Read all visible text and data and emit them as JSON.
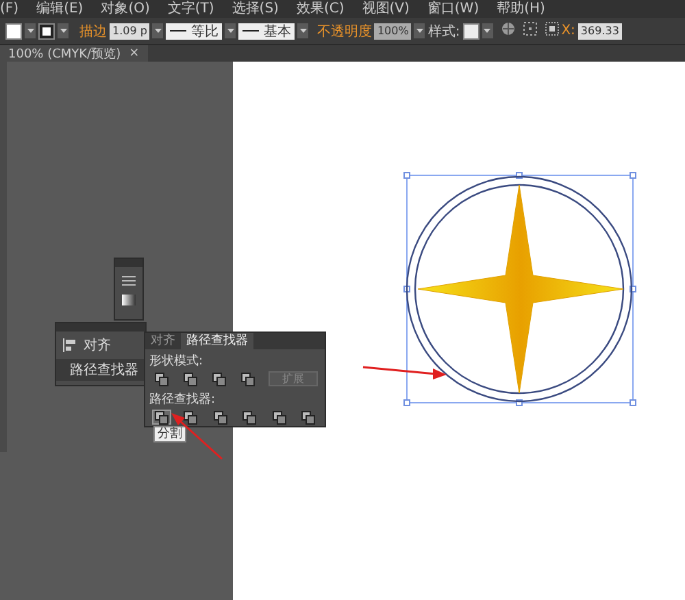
{
  "menu_bar": {
    "items": [
      "(F)",
      "编辑(E)",
      "对象(O)",
      "文字(T)",
      "选择(S)",
      "效果(C)",
      "视图(V)",
      "窗口(W)",
      "帮助(H)"
    ]
  },
  "control_bar": {
    "stroke_label": "描边",
    "stroke_weight": "1.09 p",
    "stroke_profile": "等比",
    "brush": "基本",
    "opacity_label": "不透明度",
    "opacity": "100%",
    "style_label": "样式:",
    "x_label": "X:",
    "x_value": "369.33"
  },
  "document_tab": {
    "title": "100% (CMYK/预览)",
    "close": "×"
  },
  "dock_panel": {
    "items": [
      {
        "label": "对齐",
        "selected": false
      },
      {
        "label": "路径查找器",
        "selected": true
      }
    ]
  },
  "pathfinder_panel": {
    "tabs": [
      {
        "label": "对齐",
        "selected": false
      },
      {
        "label": "路径查找器",
        "selected": true
      }
    ],
    "shape_modes_label": "形状模式:",
    "expand_button": {
      "label": "扩展",
      "disabled": true
    },
    "pathfinders_label": "路径查找器:",
    "pathfinder_buttons": [
      {
        "selected": true
      },
      {
        "selected": false
      },
      {
        "selected": false
      },
      {
        "selected": false
      },
      {
        "selected": false
      },
      {
        "selected": false
      }
    ],
    "tooltip": "分割"
  }
}
